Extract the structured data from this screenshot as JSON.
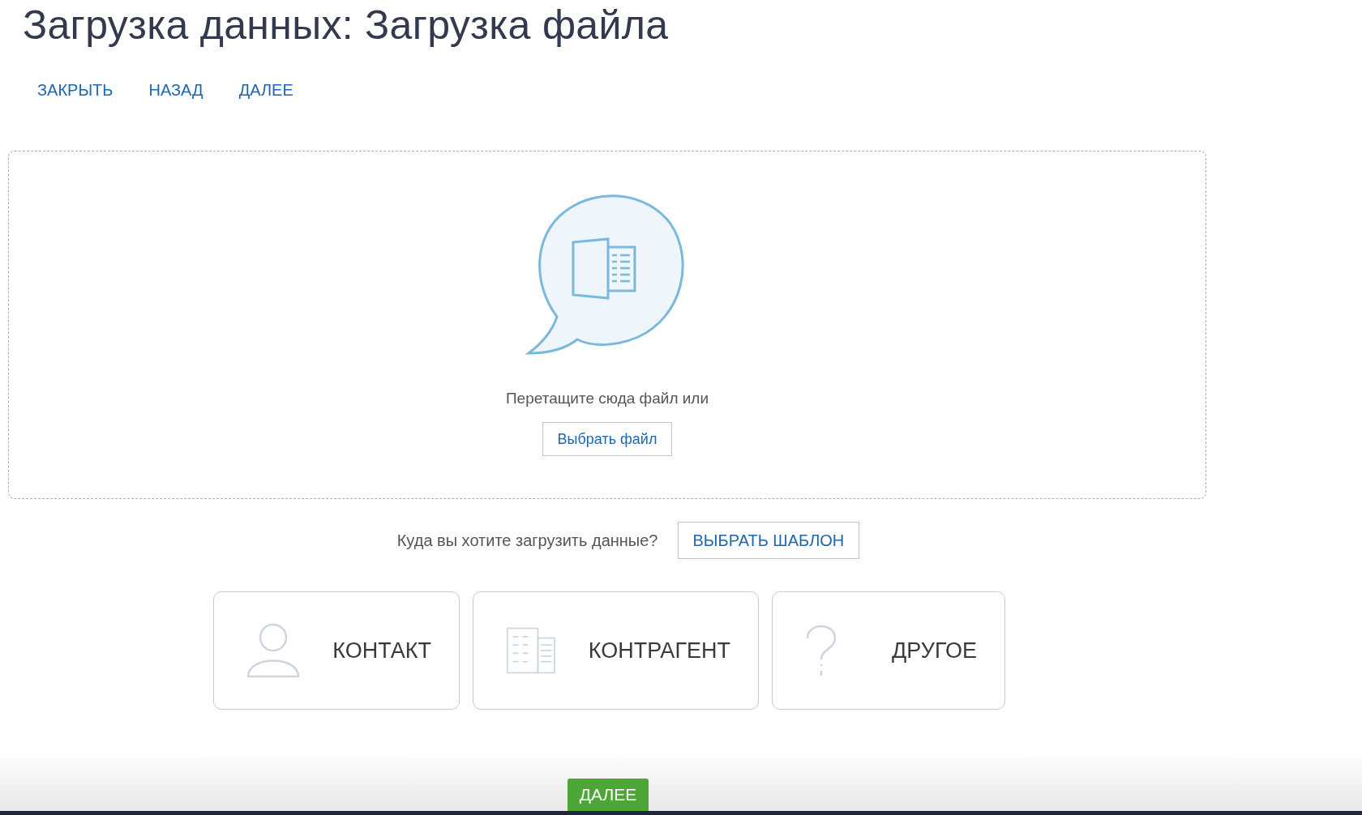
{
  "title": "Загрузка данных: Загрузка файла",
  "nav_links": [
    "ЗАКРЫТЬ",
    "НАЗАД",
    "ДАЛЕЕ"
  ],
  "dropzone": {
    "hint": "Перетащите сюда файл или",
    "button": "Выбрать файл"
  },
  "target": {
    "question": "Куда вы хотите загрузить данные?",
    "template_button": "ВЫБРАТЬ ШАБЛОН"
  },
  "cards": [
    {
      "kind": "contact",
      "label": "КОНТАКТ"
    },
    {
      "kind": "company",
      "label": "КОНТРАГЕНТ"
    },
    {
      "kind": "other",
      "label": "ДРУГОЕ"
    }
  ],
  "footer_button": "ДАЛЕЕ"
}
